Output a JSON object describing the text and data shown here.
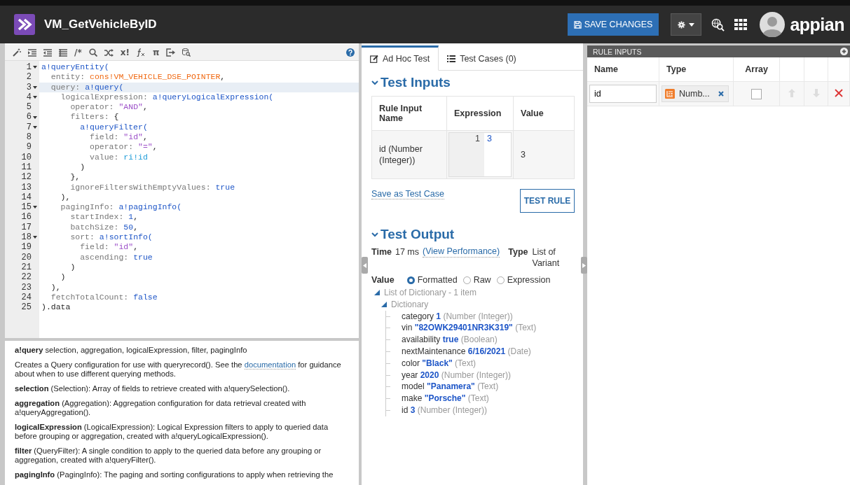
{
  "header": {
    "title": "VM_GetVehicleByID",
    "save_button": "SAVE CHANGES",
    "logo_text": "appian"
  },
  "editor": {
    "toolbar": {
      "comment_glyph": "/*",
      "error_glyph": "x!",
      "pi_glyph": "π"
    },
    "lines": [
      {
        "number": "1",
        "fold": true,
        "active": false,
        "tokens": [
          {
            "text": "a!queryEntity(",
            "kind": "fn"
          }
        ]
      },
      {
        "number": "2",
        "fold": false,
        "active": false,
        "tokens": [
          {
            "text": "  entity: ",
            "kind": "key"
          },
          {
            "text": "cons!VM_VEHICLE_DSE_POINTER",
            "kind": "const"
          },
          {
            "text": ",",
            "kind": "punct"
          }
        ]
      },
      {
        "number": "3",
        "fold": true,
        "active": true,
        "tokens": [
          {
            "text": "  query: ",
            "kind": "key"
          },
          {
            "text": "a!query(",
            "kind": "fn"
          }
        ]
      },
      {
        "number": "4",
        "fold": true,
        "active": false,
        "tokens": [
          {
            "text": "    logicalExpression: ",
            "kind": "key"
          },
          {
            "text": "a!queryLogicalExpression(",
            "kind": "fn"
          }
        ]
      },
      {
        "number": "5",
        "fold": false,
        "active": false,
        "tokens": [
          {
            "text": "      operator: ",
            "kind": "key"
          },
          {
            "text": "\"AND\"",
            "kind": "str"
          },
          {
            "text": ",",
            "kind": "punct"
          }
        ]
      },
      {
        "number": "6",
        "fold": true,
        "active": false,
        "tokens": [
          {
            "text": "      filters: ",
            "kind": "key"
          },
          {
            "text": "{",
            "kind": "punct"
          }
        ]
      },
      {
        "number": "7",
        "fold": true,
        "active": false,
        "tokens": [
          {
            "text": "        a!queryFilter(",
            "kind": "fn"
          }
        ]
      },
      {
        "number": "8",
        "fold": false,
        "active": false,
        "tokens": [
          {
            "text": "          field: ",
            "kind": "key"
          },
          {
            "text": "\"id\"",
            "kind": "str"
          },
          {
            "text": ",",
            "kind": "punct"
          }
        ]
      },
      {
        "number": "9",
        "fold": false,
        "active": false,
        "tokens": [
          {
            "text": "          operator: ",
            "kind": "key"
          },
          {
            "text": "\"=\"",
            "kind": "str"
          },
          {
            "text": ",",
            "kind": "punct"
          }
        ]
      },
      {
        "number": "10",
        "fold": false,
        "active": false,
        "tokens": [
          {
            "text": "          value: ",
            "kind": "key"
          },
          {
            "text": "ri!id",
            "kind": "var"
          }
        ]
      },
      {
        "number": "11",
        "fold": false,
        "active": false,
        "tokens": [
          {
            "text": "        )",
            "kind": "punct"
          }
        ]
      },
      {
        "number": "12",
        "fold": false,
        "active": false,
        "tokens": [
          {
            "text": "      },",
            "kind": "punct"
          }
        ]
      },
      {
        "number": "13",
        "fold": false,
        "active": false,
        "tokens": [
          {
            "text": "      ignoreFiltersWithEmptyValues: ",
            "kind": "key"
          },
          {
            "text": "true",
            "kind": "bool"
          }
        ]
      },
      {
        "number": "14",
        "fold": false,
        "active": false,
        "tokens": [
          {
            "text": "    ),",
            "kind": "punct"
          }
        ]
      },
      {
        "number": "15",
        "fold": true,
        "active": false,
        "tokens": [
          {
            "text": "    pagingInfo: ",
            "kind": "key"
          },
          {
            "text": "a!pagingInfo(",
            "kind": "fn"
          }
        ]
      },
      {
        "number": "16",
        "fold": false,
        "active": false,
        "tokens": [
          {
            "text": "      startIndex: ",
            "kind": "key"
          },
          {
            "text": "1",
            "kind": "num"
          },
          {
            "text": ",",
            "kind": "punct"
          }
        ]
      },
      {
        "number": "17",
        "fold": false,
        "active": false,
        "tokens": [
          {
            "text": "      batchSize: ",
            "kind": "key"
          },
          {
            "text": "50",
            "kind": "num"
          },
          {
            "text": ",",
            "kind": "punct"
          }
        ]
      },
      {
        "number": "18",
        "fold": true,
        "active": false,
        "tokens": [
          {
            "text": "      sort: ",
            "kind": "key"
          },
          {
            "text": "a!sortInfo(",
            "kind": "fn"
          }
        ]
      },
      {
        "number": "19",
        "fold": false,
        "active": false,
        "tokens": [
          {
            "text": "        field: ",
            "kind": "key"
          },
          {
            "text": "\"id\"",
            "kind": "str"
          },
          {
            "text": ",",
            "kind": "punct"
          }
        ]
      },
      {
        "number": "20",
        "fold": false,
        "active": false,
        "tokens": [
          {
            "text": "        ascending: ",
            "kind": "key"
          },
          {
            "text": "true",
            "kind": "bool"
          }
        ]
      },
      {
        "number": "21",
        "fold": false,
        "active": false,
        "tokens": [
          {
            "text": "      )",
            "kind": "punct"
          }
        ]
      },
      {
        "number": "22",
        "fold": false,
        "active": false,
        "tokens": [
          {
            "text": "    )",
            "kind": "punct"
          }
        ]
      },
      {
        "number": "23",
        "fold": false,
        "active": false,
        "tokens": [
          {
            "text": "  ),",
            "kind": "punct"
          }
        ]
      },
      {
        "number": "24",
        "fold": false,
        "active": false,
        "tokens": [
          {
            "text": "  fetchTotalCount: ",
            "kind": "key"
          },
          {
            "text": "false",
            "kind": "bool"
          }
        ]
      },
      {
        "number": "25",
        "fold": false,
        "active": false,
        "tokens": [
          {
            "text": ").data",
            "kind": "punct"
          }
        ]
      }
    ]
  },
  "documentation": {
    "signature": "**a!query**  selection, aggregation, logicalExpression, filter, pagingInfo",
    "description": {
      "before": "Creates a Query configuration for use with queryrecord(). See the ",
      "link": "documentation",
      "after": " for guidance about when to use different querying methods."
    },
    "parameters": [
      "**selection** (Selection): Array of fields to retrieve created with a!querySelection().",
      "**aggregation** (Aggregation): Aggregation configuration for data retrieval created with a!queryAggregation().",
      "**logicalExpression** (LogicalExpression): Logical Expression filters to apply to queried data before grouping or aggregation, created with a!queryLogicalExpression().",
      "**filter** (QueryFilter): A single condition to apply to the queried data before any grouping or aggregation, created with a!queryFilter().",
      "**pagingInfo** (PagingInfo): The paging and sorting configurations to apply when retrieving the"
    ]
  },
  "test_panel": {
    "tabs": [
      {
        "label": "Ad Hoc Test",
        "selected": true
      },
      {
        "label": "Test Cases (0)",
        "selected": false
      }
    ],
    "inputs_heading": "Test Inputs",
    "inputs_expanded": true,
    "table": {
      "columns": [
        "Rule Input Name",
        "Expression",
        "Value"
      ],
      "rows": [
        {
          "name": "id (Number (Integer))",
          "line_number": "1",
          "expression": "3",
          "value": "3"
        }
      ]
    },
    "save_link": "Save as Test Case",
    "test_button": "TEST RULE",
    "output_heading": "Test Output",
    "output_expanded": true,
    "time_label": "Time",
    "time_value": "17 ms",
    "performance_link": "(View Performance)",
    "type_label": "Type",
    "type_value": "List of Variant",
    "value_label": "Value",
    "value_modes": [
      {
        "label": "Formatted",
        "selected": true
      },
      {
        "label": "Raw",
        "selected": false
      },
      {
        "label": "Expression",
        "selected": false
      }
    ],
    "tree": {
      "label": "List of Dictionary - 1 item",
      "expanded": true,
      "children": [
        {
          "label": "Dictionary",
          "expanded": true,
          "children": [
            {
              "name": "category",
              "value": "1",
              "type": "(Number (Integer))"
            },
            {
              "name": "vin",
              "value": "\"82OWK29401NR3K319\"",
              "type": "(Text)"
            },
            {
              "name": "availability",
              "value": "true",
              "type": "(Boolean)"
            },
            {
              "name": "nextMaintenance",
              "value": "6/16/2021",
              "type": "(Date)"
            },
            {
              "name": "color",
              "value": "\"Black\"",
              "type": "(Text)"
            },
            {
              "name": "year",
              "value": "2020",
              "type": "(Number (Integer))"
            },
            {
              "name": "model",
              "value": "\"Panamera\"",
              "type": "(Text)"
            },
            {
              "name": "make",
              "value": "\"Porsche\"",
              "type": "(Text)"
            },
            {
              "name": "id",
              "value": "3",
              "type": "(Number (Integer))"
            }
          ]
        }
      ]
    }
  },
  "rule_inputs": {
    "title": "RULE INPUTS",
    "columns": [
      "Name",
      "Type",
      "Array"
    ],
    "rows": [
      {
        "name": "id",
        "type": "Numb...",
        "array": false,
        "can_move_up": false,
        "can_move_down": false
      }
    ]
  }
}
